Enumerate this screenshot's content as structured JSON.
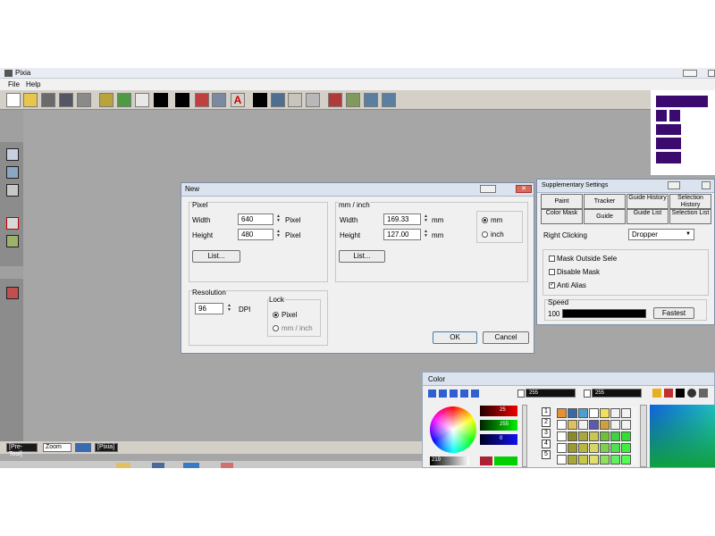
{
  "app": {
    "title": "Pixia",
    "menu": [
      "File",
      "Help"
    ]
  },
  "status": {
    "items": [
      "[Pre-Tool]",
      "Zoom",
      "[Pixia]"
    ]
  },
  "new_dialog": {
    "title": "New",
    "pixel_group": "Pixel",
    "mm_group": "mm / inch",
    "width_label": "Width",
    "height_label": "Height",
    "width_px": "640",
    "height_px": "480",
    "pixel_unit": "Pixel",
    "width_mm": "169.33",
    "height_mm": "127.00",
    "mm_unit": "mm",
    "list_label": "List...",
    "radio_mm": "mm",
    "radio_inch": "inch",
    "resolution_group": "Resolution",
    "resolution_value": "96",
    "dpi_label": "DPI",
    "lock_group": "Lock",
    "lock_pixel": "Pixel",
    "lock_mm": "mm / inch",
    "ok_label": "OK",
    "cancel_label": "Cancel"
  },
  "supp": {
    "title": "Supplementary Settings",
    "row1": [
      "Paint",
      "Tracker",
      "Guide History",
      "Selection History"
    ],
    "row2": [
      "Color Mask",
      "Guide",
      "Guide List",
      "Selection List"
    ],
    "right_click_label": "Right Clicking",
    "right_click_value": "Dropper",
    "mask_outside": "Mask Outside Sele",
    "disable_mask": "Disable Mask",
    "anti_alias": "Anti Alias",
    "speed_label": "Speed",
    "speed_value": "100",
    "speed_fraction": 1.0,
    "fastest_label": "Fastest"
  },
  "color": {
    "title": "Color",
    "field1": "255",
    "field2": "255",
    "rgb_values": [
      "25",
      "255",
      "0"
    ],
    "field_219": "219",
    "side_numbers": [
      "1",
      "2",
      "3",
      "4",
      "5"
    ]
  },
  "colors": {
    "accent": "#3a0a6e",
    "titlebar": "#dbe3ee",
    "palette_blue": "#2f5fd1"
  }
}
